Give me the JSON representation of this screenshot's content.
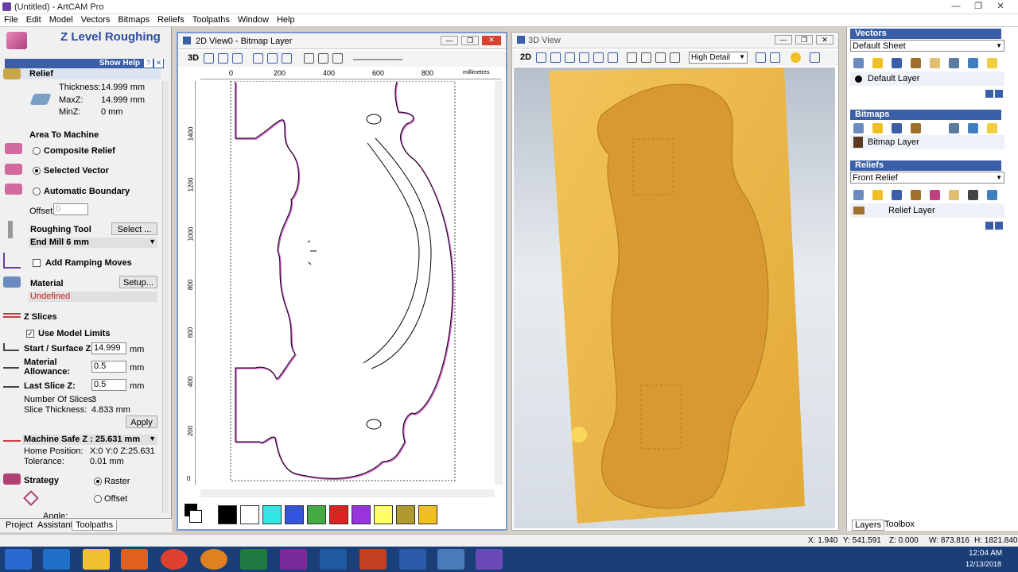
{
  "app": {
    "title": "(Untitled) - ArtCAM Pro"
  },
  "menu": [
    "File",
    "Edit",
    "Model",
    "Vectors",
    "Bitmaps",
    "Reliefs",
    "Toolpaths",
    "Window",
    "Help"
  ],
  "left": {
    "title": "Z Level Roughing",
    "show_help": "Show Help",
    "relief_label": "Relief",
    "thickness_label": "Thickness:",
    "thickness": "14.999 mm",
    "maxz_label": "MaxZ:",
    "maxz": "14.999 mm",
    "minz_label": "MinZ:",
    "minz": "0 mm",
    "area_label": "Area To Machine",
    "composite": "Composite Relief",
    "selected": "Selected Vector",
    "automatic": "Automatic Boundary",
    "offset_label": "Offset",
    "offset_value": "0",
    "roughing_tool": "Roughing Tool",
    "select_btn": "Select ...",
    "tool_value": "End Mill 6 mm",
    "ramping": "Add Ramping Moves",
    "material": "Material",
    "setup_btn": "Setup...",
    "undefined": "Undefined",
    "zslices": "Z Slices",
    "use_limits": "Use Model Limits",
    "start_label": "Start / Surface Z:",
    "start_value": "14.999",
    "mm1": "mm",
    "allow_label1": "Material",
    "allow_label2": "Allowance:",
    "allow_value": "0.5",
    "mm2": "mm",
    "last_label": "Last Slice Z:",
    "last_value": "0.5",
    "mm3": "mm",
    "num_slices_label": "Number Of Slices:",
    "num_slices": "3",
    "slice_thick_label": "Slice Thickness:",
    "slice_thick": "4.833 mm",
    "apply_btn": "Apply",
    "machine_safe": "Machine Safe Z : 25.631 mm",
    "home_label": "Home Position:",
    "home_value": "X:0 Y:0 Z:25.631",
    "tol_label": "Tolerance:",
    "tol_value": "0.01 mm",
    "strategy": "Strategy",
    "raster": "Raster",
    "offset_opt": "Offset",
    "angle": "Angle:"
  },
  "bottom_tabs": [
    "Project",
    "Assistant",
    "Toolpaths"
  ],
  "view2d": {
    "title": "2D View0 - Bitmap Layer",
    "mode": "3D",
    "units": "millimetres",
    "xticks": [
      "0",
      "200",
      "400",
      "600",
      "800"
    ],
    "yticks": [
      "1400",
      "1200",
      "1000",
      "800",
      "600",
      "400",
      "200",
      "0"
    ]
  },
  "view3d": {
    "title": "3D View",
    "mode": "2D",
    "detail": "High Detail"
  },
  "swatches": [
    "#000000",
    "#ffffff",
    "#33e6e6",
    "#3355dd",
    "#44aa44",
    "#dd2222",
    "#9933dd",
    "#ffff66",
    "#b09a30",
    "#f0c020"
  ],
  "right": {
    "vectors": "Vectors",
    "vectors_sheet": "Default Sheet",
    "default_layer": "Default Layer",
    "bitmaps": "Bitmaps",
    "bitmap_layer": "Bitmap Layer",
    "reliefs": "Reliefs",
    "front_relief": "Front Relief",
    "relief_layer": "Relief Layer",
    "tabs": [
      "Layers",
      "Toolbox"
    ]
  },
  "status": {
    "x": "X: 1.940",
    "y": "Y: 541.591",
    "z": "Z: 0.000",
    "w": "W: 873.816",
    "h": "H: 1821.840"
  },
  "clock": {
    "time": "12:04 AM",
    "date": "12/13/2018"
  }
}
